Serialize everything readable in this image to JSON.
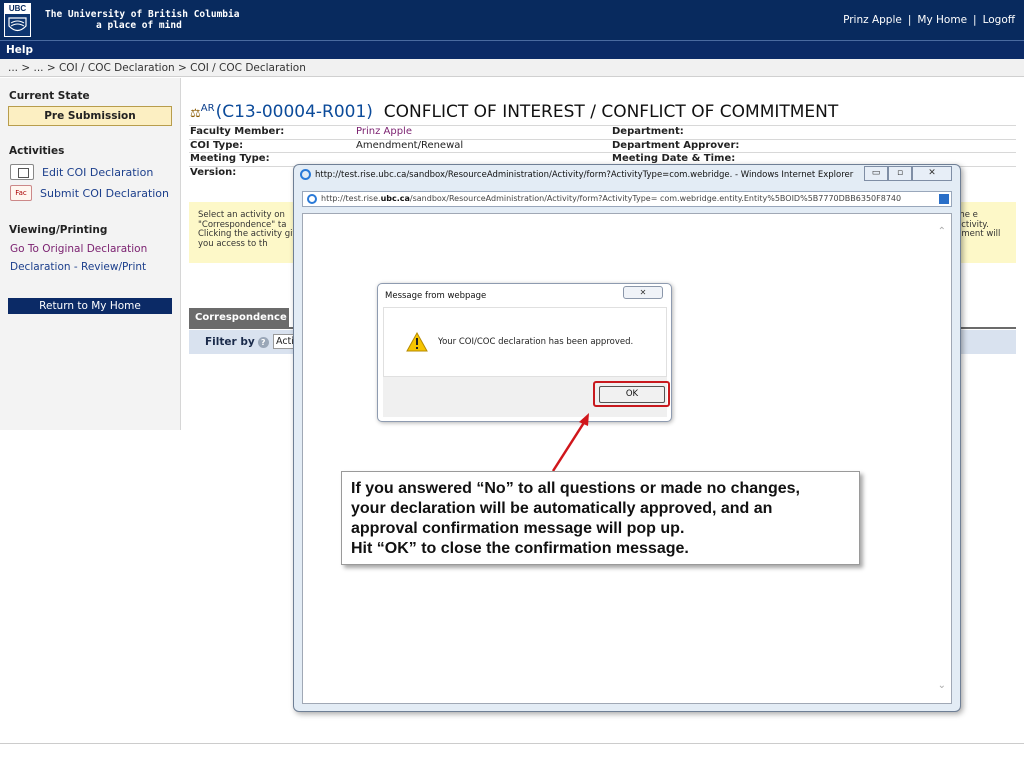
{
  "header": {
    "logo_text": "UBC",
    "university_line1": "The University of British Columbia",
    "university_line2": "a place of mind",
    "user_name": "Prinz Apple",
    "my_home": "My Home",
    "logoff": "Logoff",
    "separator": "|"
  },
  "helpbar": {
    "label": "Help"
  },
  "breadcrumb": {
    "text": "... > ... > COI / COC Declaration  > COI / COC Declaration"
  },
  "sidebar": {
    "current_state_heading": "Current State",
    "state_value": "Pre Submission",
    "activities_heading": "Activities",
    "activities": [
      {
        "label": "Edit COI Declaration",
        "icon": "edit-form-icon"
      },
      {
        "label": "Submit COI Declaration",
        "icon": "fac-icon",
        "icon_text": "Fac"
      }
    ],
    "viewing_heading": "Viewing/Printing",
    "view_links": [
      "Go To Original Declaration",
      "Declaration - Review/Print"
    ],
    "return_button": "Return to My Home"
  },
  "main": {
    "title_tag": "AR",
    "title_id": "(C13-00004-R001)",
    "title_text": "CONFLICT OF INTEREST / CONFLICT OF COMMITMENT",
    "info": [
      {
        "label": "Faculty Member:",
        "value": "Prinz Apple",
        "label2": "Department:"
      },
      {
        "label": "COI Type:",
        "value": "Amendment/Renewal",
        "label2": "Department Approver:"
      },
      {
        "label": "Meeting Type:",
        "value": "",
        "label2": "Meeting Date & Time:"
      },
      {
        "label": "Version:",
        "value": "",
        "label2": ""
      }
    ],
    "note_left": "Select an activity on \"Correspondence\" ta Clicking the activity give you access to th",
    "note_right": "the e activity. dment will",
    "correspondence_tab": "Correspondence",
    "filter_label": "Filter by",
    "filter_value": "Acti"
  },
  "ie_window": {
    "title": "http://test.rise.ubc.ca/sandbox/ResourceAdministration/Activity/form?ActivityType=com.webridge. - Windows Internet Explorer",
    "address_prefix": "http://test.rise.",
    "address_domain": "ubc.ca",
    "address_rest": "/sandbox/ResourceAdministration/Activity/form?ActivityType= com.webridge.entity.Entity%5BOID%5B7770DBB6350F8740",
    "controls": {
      "minimize": "▭",
      "maximize": "▫",
      "close": "✕"
    }
  },
  "dialog": {
    "title": "Message from webpage",
    "close": "✕",
    "message": "Your COI/COC declaration has been approved.",
    "ok": "OK"
  },
  "callout": {
    "lines": [
      "If you answered “No” to all questions or made no changes,",
      "your declaration will be automatically approved, and an",
      "approval confirmation message will pop up.",
      "Hit “OK” to close the confirmation message."
    ]
  },
  "colors": {
    "header_bg": "#082a5e",
    "state_box": "#fcefc2",
    "highlight_ring": "#c8191e",
    "note_bg": "#fdf8c8"
  }
}
